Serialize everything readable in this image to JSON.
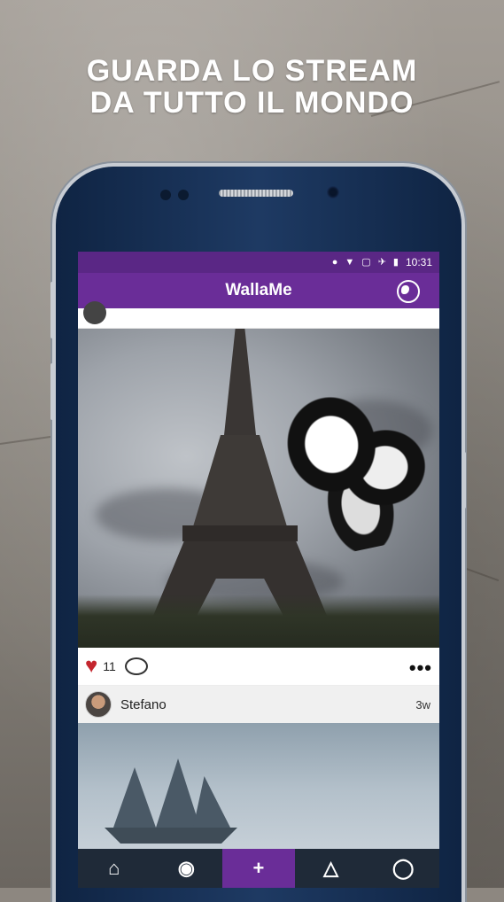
{
  "headline": {
    "line1": "GUARDA LO STREAM",
    "line2": "DA TUTTO IL MONDO"
  },
  "status_bar": {
    "time": "10:31"
  },
  "app_bar": {
    "title": "WallaMe",
    "globe_icon": "globe-icon"
  },
  "post1": {
    "likes": "11"
  },
  "post2": {
    "username": "Stefano",
    "time": "3w"
  },
  "bottom_nav": [
    {
      "icon": "home-icon",
      "label": "⌂"
    },
    {
      "icon": "eye-icon",
      "label": "◉"
    },
    {
      "icon": "add-icon",
      "label": "+"
    },
    {
      "icon": "triangle-network-icon",
      "label": "△"
    },
    {
      "icon": "profile-icon",
      "label": "◯"
    }
  ],
  "colors": {
    "purple": "#6a2d98",
    "heart": "#c4262e"
  }
}
